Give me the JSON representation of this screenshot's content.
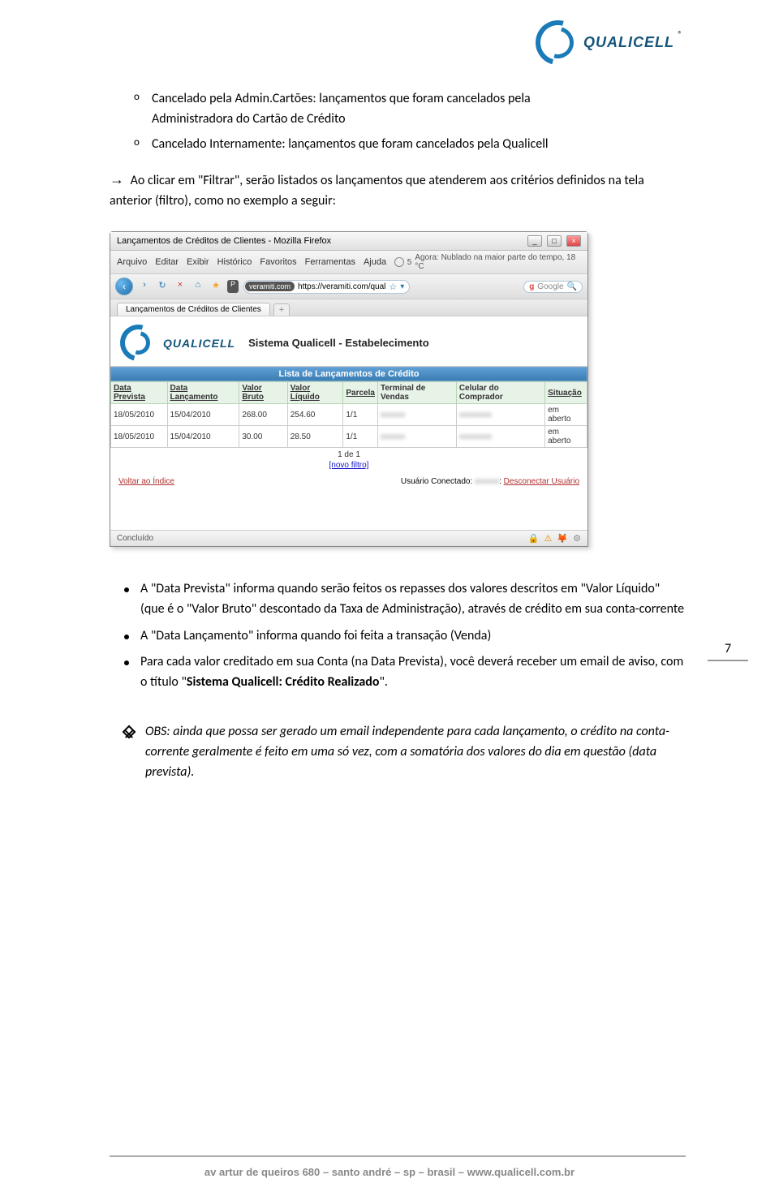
{
  "logo": {
    "brand": "QUALICELL",
    "reg": "®"
  },
  "top_list": {
    "item1_prefix": "Cancelado pela Admin.Cartões: lançamentos que foram cancelados pela",
    "item1_line2": "Administradora do Cartão de Crédito",
    "item2": "Cancelado Internamente: lançamentos que foram cancelados pela Qualicell"
  },
  "arrow_para": "Ao clicar em \"Filtrar\", serão listados os lançamentos que atenderem aos critérios definidos na tela anterior (filtro), como no exemplo a seguir:",
  "browser": {
    "title": "Lançamentos de Créditos de Clientes - Mozilla Firefox",
    "menu": {
      "arquivo": "Arquivo",
      "editar": "Editar",
      "exibir": "Exibir",
      "historico": "Histórico",
      "favoritos": "Favoritos",
      "ferramentas": "Ferramentas",
      "ajuda": "Ajuda",
      "weather_num": "5",
      "weather_text": "Agora: Nublado na maior parte do tempo, 18 °C"
    },
    "nav": {
      "url_host": "veramiti.com",
      "url_path": "https://veramiti.com/qual",
      "search_placeholder": "Google"
    },
    "tab": "Lançamentos de Créditos de Clientes",
    "page": {
      "sys_title": "Sistema Qualicell - Estabelecimento",
      "list_header": "Lista de Lançamentos de Crédito",
      "columns": {
        "data_prevista": "Data Prevista",
        "data_lancamento": "Data Lançamento",
        "valor_bruto": "Valor Bruto",
        "valor_liquido": "Valor Líquido",
        "parcela": "Parcela",
        "terminal": "Terminal de Vendas",
        "celular": "Celular do Comprador",
        "situacao": "Situação"
      },
      "rows": [
        {
          "data_prevista": "18/05/2010",
          "data_lanc": "15/04/2010",
          "bruto": "268.00",
          "liquido": "254.60",
          "parcela": "1/1",
          "terminal": "",
          "celular": "",
          "situacao": "em aberto"
        },
        {
          "data_prevista": "18/05/2010",
          "data_lanc": "15/04/2010",
          "bruto": "30.00",
          "liquido": "28.50",
          "parcela": "1/1",
          "terminal": "",
          "celular": "",
          "situacao": "em aberto"
        }
      ],
      "pager": "1 de 1",
      "novo_filtro": "[novo filtro]",
      "voltar": "Voltar ao Índice",
      "usuario_label": "Usuário Conectado:",
      "desconectar": "Desconectar Usuário",
      "status": "Concluído"
    }
  },
  "page_number": "7",
  "bottom_bullets": {
    "b1": "A \"Data Prevista\" informa quando serão feitos os repasses dos valores descritos em \"Valor Líquido\" (que é o \"Valor Bruto\" descontado da Taxa de Administração), através de crédito em sua conta-corrente",
    "b2": "A \"Data Lançamento\" informa quando foi feita a transação (Venda)",
    "b3_pre": "Para cada valor creditado em sua Conta (na Data Prevista), você deverá receber um email de aviso, com o título \"",
    "b3_bold": "Sistema Qualicell: Crédito Realizado",
    "b3_post": "\"."
  },
  "obs": "OBS: ainda que possa ser gerado um email independente para cada lançamento, o crédito na conta-corrente geralmente é feito em uma só vez, com a somatória dos valores do dia em questão (data prevista).",
  "footer": "av artur de queiros 680 – santo andré – sp – brasil – www.qualicell.com.br"
}
